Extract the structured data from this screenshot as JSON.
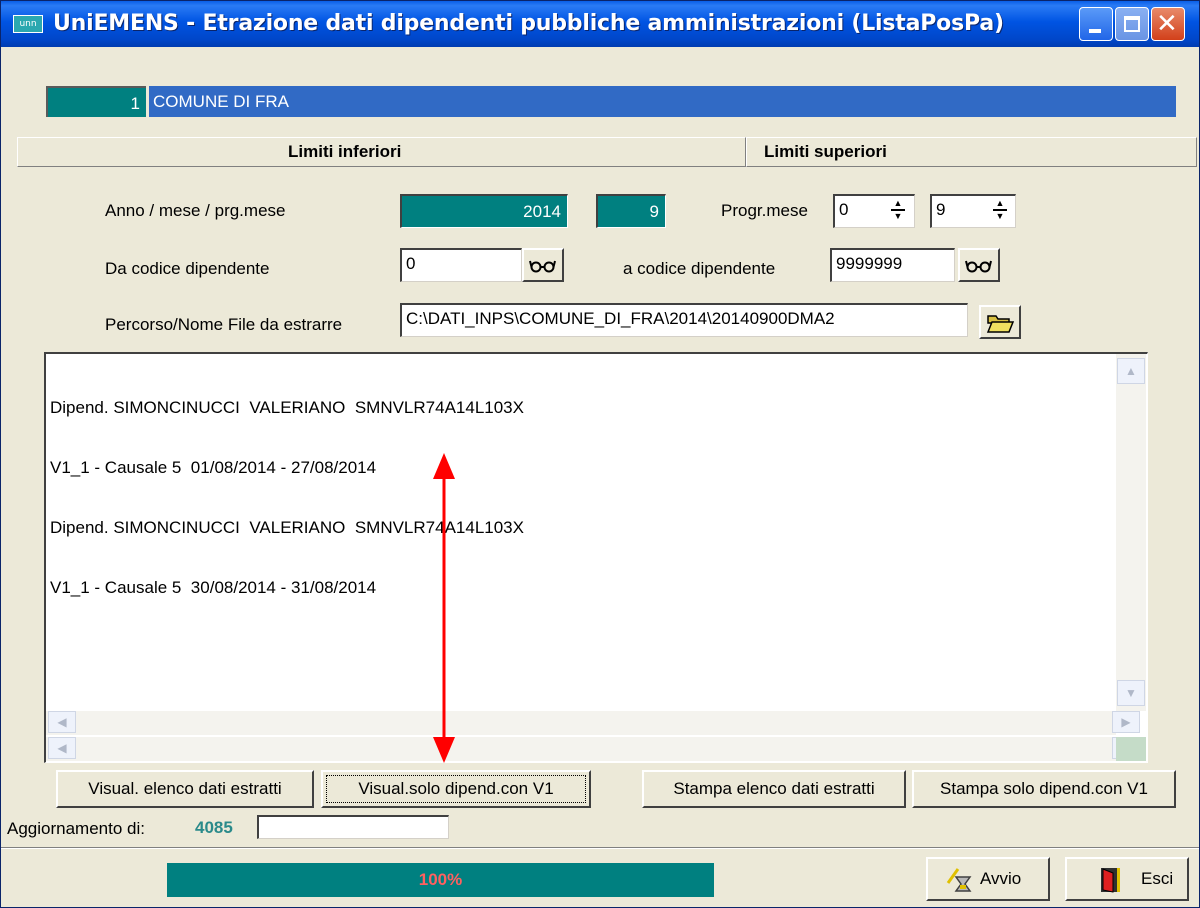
{
  "window": {
    "title": "UniEMENS - Etrazione dati dipendenti  pubbliche amministrazioni (ListaPosPa)",
    "app_icon_text": "unn"
  },
  "ente": {
    "code": "1",
    "name": "COMUNE DI FRA"
  },
  "limits": {
    "lower_label": "Limiti inferiori",
    "upper_label": "Limiti superiori"
  },
  "form": {
    "anno_label": "Anno / mese / prg.mese",
    "anno": "2014",
    "mese": "9",
    "progr_label": "Progr.mese",
    "progr_from": "0",
    "progr_to": "9",
    "da_codice_label": "Da codice dipendente",
    "da_codice": "0",
    "a_codice_label": "a codice dipendente",
    "a_codice": "9999999",
    "percorso_label": "Percorso/Nome File da estrarre",
    "percorso": "C:\\DATI_INPS\\COMUNE_DI_FRA\\2014\\20140900DMA2"
  },
  "output": {
    "lines": [
      "Dipend. SIMONCINUCCI  VALERIANO  SMNVLR74A14L103X",
      "V1_1 - Causale 5  01/08/2014 - 27/08/2014",
      "Dipend. SIMONCINUCCI  VALERIANO  SMNVLR74A14L103X",
      "V1_1 - Causale 5  30/08/2014 - 31/08/2014"
    ]
  },
  "buttons": {
    "visual_elenco": "Visual. elenco dati estratti",
    "visual_solo": "Visual.solo dipend.con V1",
    "stampa_elenco": "Stampa elenco dati estratti",
    "stampa_solo": "Stampa solo dipend.con V1",
    "avvio": "Avvio",
    "esci": "Esci"
  },
  "status": {
    "aggiornamento_label": "Aggiornamento di:",
    "aggiornamento_value": "4085",
    "progress_text": "100%",
    "progress_value": 1.0
  },
  "colors": {
    "teal": "#008080",
    "selection_blue": "#316ac5",
    "window_bg": "#ece9d8",
    "annotation_red": "#ff0000",
    "aggiornamento_value": "#2a8a8a"
  }
}
